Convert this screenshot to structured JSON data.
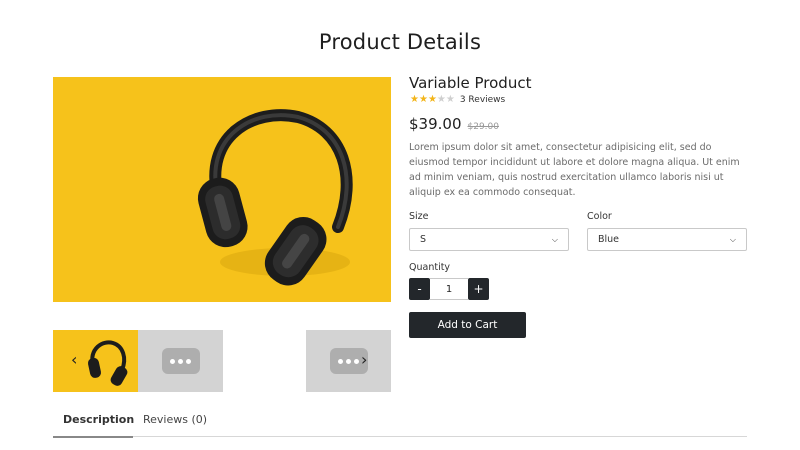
{
  "page": {
    "title": "Product Details"
  },
  "product": {
    "name": "Variable Product",
    "rating": 3,
    "rating_max": 5,
    "reviews_label": "3 Reviews",
    "price": "$39.00",
    "old_price": "$29.00",
    "description": "Lorem ipsum dolor sit amet, consectetur adipisicing elit, sed do eiusmod tempor incididunt ut labore et dolore magna aliqua. Ut enim ad minim veniam, quis nostrud exercitation ullamco laboris nisi ut aliquip ex ea commodo consequat."
  },
  "options": {
    "size_label": "Size",
    "size_value": "S",
    "color_label": "Color",
    "color_value": "Blue"
  },
  "quantity": {
    "label": "Quantity",
    "minus": "-",
    "value": "1",
    "plus": "+"
  },
  "actions": {
    "add_to_cart": "Add to Cart"
  },
  "gallery": {
    "prev_icon": "‹",
    "next_icon": "›"
  },
  "tabs": [
    {
      "label": "Description",
      "active": true
    },
    {
      "label": "Reviews (0)",
      "active": false
    }
  ],
  "colors": {
    "accent_yellow": "#f6c21b",
    "star": "#f3b51a",
    "button_dark": "#23272b"
  }
}
